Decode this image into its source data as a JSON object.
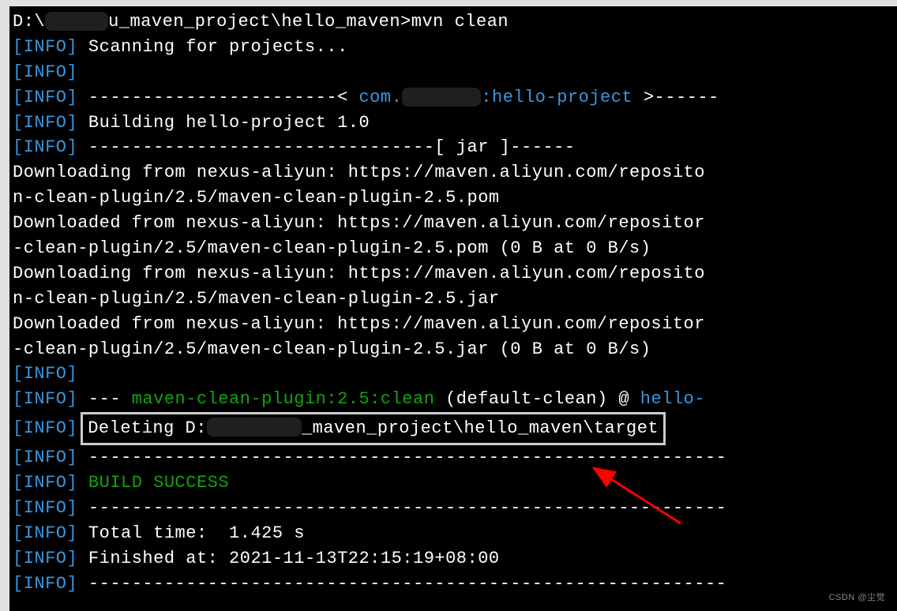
{
  "prompt": {
    "path_prefix": "D:\\",
    "path_suffix": "u_maven_project\\hello_maven>",
    "command": "mvn clean"
  },
  "lines": {
    "scanning": " Scanning for projects...",
    "dash_left": " -----------------------< ",
    "project_group_prefix": "com.",
    "project_artifact": ":hello-project",
    "dash_right": " >------",
    "building": " Building hello-project 1.0",
    "jar_line": " --------------------------------[ jar ]------",
    "download1a": "Downloading from nexus-aliyun: https://maven.aliyun.com/reposito",
    "download1b": "n-clean-plugin/2.5/maven-clean-plugin-2.5.pom",
    "download2a": "Downloaded from nexus-aliyun: https://maven.aliyun.com/repositor",
    "download2b": "-clean-plugin/2.5/maven-clean-plugin-2.5.pom (0 B at 0 B/s)",
    "download3a": "Downloading from nexus-aliyun: https://maven.aliyun.com/reposito",
    "download3b": "n-clean-plugin/2.5/maven-clean-plugin-2.5.jar",
    "download4a": "Downloaded from nexus-aliyun: https://maven.aliyun.com/repositor",
    "download4b": "-clean-plugin/2.5/maven-clean-plugin-2.5.jar (0 B at 0 B/s)",
    "plugin_dash": " --- ",
    "plugin_name": "maven-clean-plugin:2.5:clean",
    "plugin_default": " (default-clean) @ ",
    "plugin_proj": "hello-",
    "deleting_prefix": "Deleting D:",
    "deleting_suffix": "_maven_project\\hello_maven\\target",
    "dashes": " -----------------------------------------------------------",
    "build_success": " BUILD SUCCESS",
    "total_time": " Total time:  1.425 s",
    "finished": " Finished at: 2021-11-13T22:15:19+08:00"
  },
  "info_tag": {
    "open": "[",
    "label": "INFO",
    "close": "]"
  },
  "watermark": "CSDN @尘觉"
}
